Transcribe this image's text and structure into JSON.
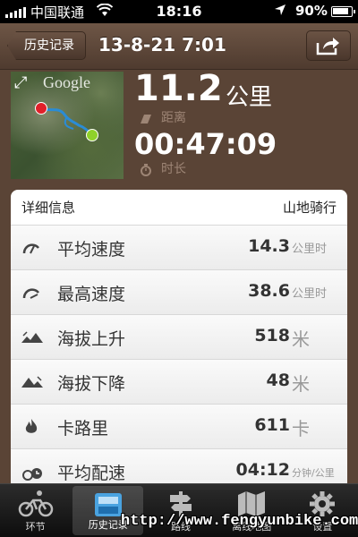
{
  "status_bar": {
    "carrier": "中国联通",
    "time": "18:16",
    "battery": "90%"
  },
  "nav": {
    "back_label": "历史记录",
    "title": "13-8-21 7:01"
  },
  "map": {
    "brand": "Google"
  },
  "summary": {
    "distance_value": "11.2",
    "distance_unit": "公里",
    "distance_label": "距离",
    "duration_value": "00:47:09",
    "duration_label": "时长"
  },
  "details": {
    "header_left": "详细信息",
    "header_right": "山地骑行",
    "rows": [
      {
        "icon": "speedometer-icon",
        "label": "平均速度",
        "value": "14.3",
        "unit": "公里时"
      },
      {
        "icon": "max-speed-icon",
        "label": "最高速度",
        "value": "38.6",
        "unit": "公里时"
      },
      {
        "icon": "elevation-gain-icon",
        "label": "海拔上升",
        "value": "518",
        "unit": "米"
      },
      {
        "icon": "elevation-loss-icon",
        "label": "海拔下降",
        "value": "48",
        "unit": "米"
      },
      {
        "icon": "flame-icon",
        "label": "卡路里",
        "value": "611",
        "unit": "卡"
      },
      {
        "icon": "pace-icon",
        "label": "平均配速",
        "value": "04:12",
        "unit": "分钟/公里"
      }
    ]
  },
  "tabs": [
    {
      "icon": "cyclist-icon",
      "label": "环节"
    },
    {
      "icon": "history-tray-icon",
      "label": "历史记录"
    },
    {
      "icon": "signpost-icon",
      "label": "路线"
    },
    {
      "icon": "map-icon",
      "label": "离线地图"
    },
    {
      "icon": "gear-icon",
      "label": "设置"
    }
  ],
  "watermark": "http://www.fengyunbike.com"
}
